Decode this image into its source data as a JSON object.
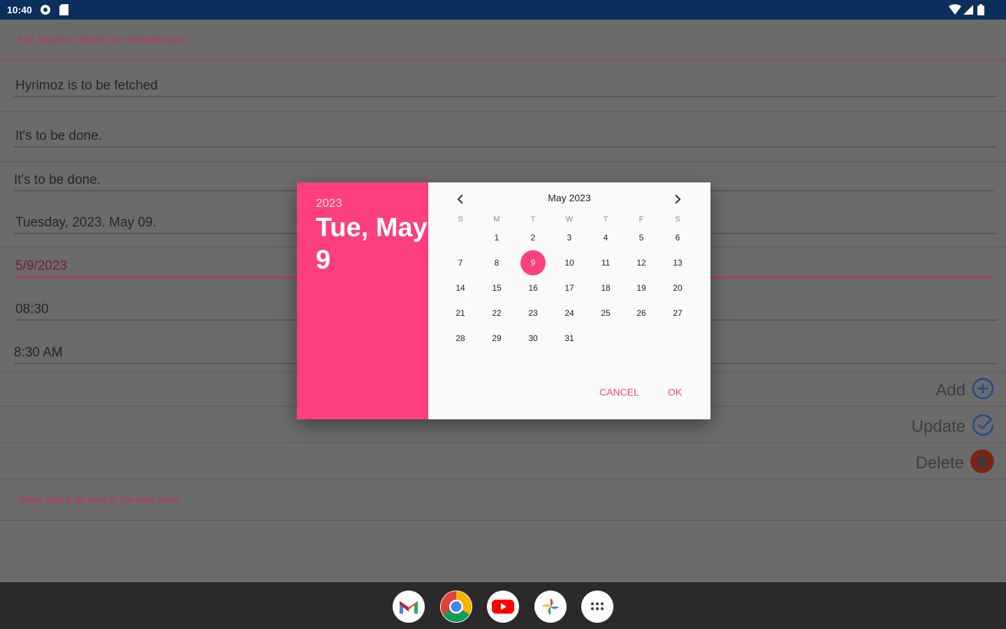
{
  "status": {
    "time": "10:40"
  },
  "form": {
    "header_hint": "Edit, delete or update your timetable here.",
    "fields": [
      "Hyrimoz is to be fetched",
      "It's to be done.",
      "It's to be done.",
      "Tuesday, 2023. May 09.",
      "5/9/2023",
      "08:30",
      "8:30 AM"
    ],
    "footer_hint": "Swipe right to go back to the table view!",
    "actions": {
      "add": "Add",
      "update": "Update",
      "delete": "Delete"
    }
  },
  "dialog": {
    "year": "2023",
    "date_label": "Tue, May 9",
    "month_label": "May 2023",
    "weekdays": [
      "S",
      "M",
      "T",
      "W",
      "T",
      "F",
      "S"
    ],
    "days": [
      "1",
      "2",
      "3",
      "4",
      "5",
      "6",
      "7",
      "8",
      "9",
      "10",
      "11",
      "12",
      "13",
      "14",
      "15",
      "16",
      "17",
      "18",
      "19",
      "20",
      "21",
      "22",
      "23",
      "24",
      "25",
      "26",
      "27",
      "28",
      "29",
      "30",
      "31"
    ],
    "selected_day": "9",
    "cancel": "CANCEL",
    "ok": "OK"
  },
  "colors": {
    "accent": "#fd3f7d",
    "hint": "#c2305e",
    "statusbar": "#0b2f5a"
  },
  "taskbar_icons": [
    "gmail-icon",
    "chrome-icon",
    "youtube-icon",
    "photos-icon",
    "app-launcher-icon"
  ]
}
